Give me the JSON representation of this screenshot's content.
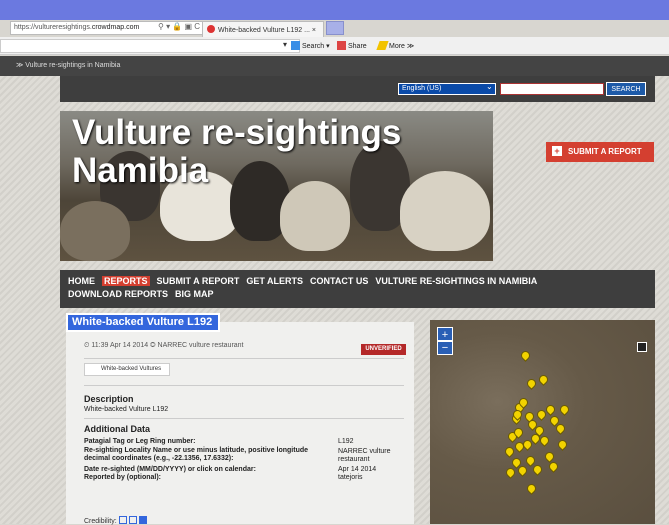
{
  "browser": {
    "url_prefix": "https://vultureresightings.",
    "url_domain": "crowdmap.com",
    "url_icons": "⚲ ▾ 🔒 ▣ C",
    "tab_title": "White-backed Vulture L192 ...",
    "tab_close": "×",
    "toolbar": {
      "dropdown": "▾",
      "search": "Search",
      "search_arrow": "▾",
      "share": "Share",
      "more": "More ≫"
    },
    "bookmark": "≫  Vulture re-sightings in Namibia"
  },
  "site": {
    "language": "English (US)",
    "language_arrow": "⌄",
    "search_button": "SEARCH",
    "banner_title_line1": "Vulture re-sightings",
    "banner_title_line2": "Namibia",
    "submit_report_button": "SUBMIT A REPORT",
    "submit_plus": "+",
    "nav": [
      "HOME",
      "REPORTS",
      "SUBMIT A REPORT",
      "GET ALERTS",
      "CONTACT US",
      "VULTURE RE-SIGHTINGS IN NAMIBIA",
      "DOWNLOAD REPORTS",
      "BIG MAP"
    ],
    "nav_active_index": 1
  },
  "report": {
    "title": "White-backed Vulture L192",
    "meta": "⏲ 11:39 Apr 14 2014  ◎ NARREC vulture restaurant",
    "status": "UNVERIFIED",
    "category": "White-backed Vultures",
    "description_heading": "Description",
    "description": "White-backed Vulture L192",
    "additional_heading": "Additional Data",
    "fields": [
      {
        "label": "Patagial Tag or Leg Ring number:",
        "value": "L192"
      },
      {
        "label": "Re-sighting Locality Name or use minus latitude, positive longitude decimal coordinates (e.g., -22.1356, 17.6332):",
        "value": "NARREC vulture restaurant"
      },
      {
        "label": "Date re-sighted (MM/DD/YYYY) or click on calendar:",
        "value": "Apr 14 2014"
      },
      {
        "label": "Reported by (optional):",
        "value": "tatejoris"
      }
    ],
    "credibility": "Credibility:"
  },
  "map": {
    "zoom_in": "+",
    "zoom_out": "−"
  },
  "colors": {
    "accent_red": "#d43f30",
    "accent_blue": "#3366dd",
    "pin_yellow": "#f2d300"
  }
}
